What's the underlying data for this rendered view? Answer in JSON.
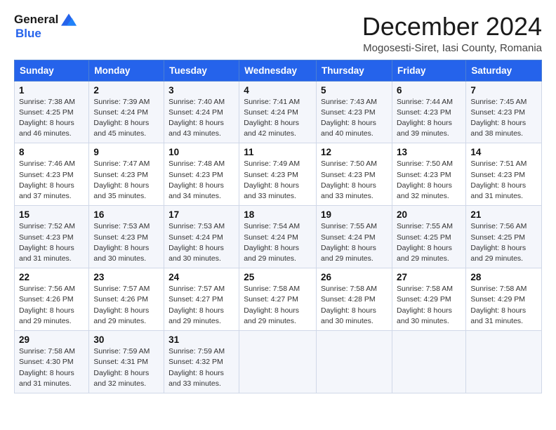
{
  "logo": {
    "general": "General",
    "blue": "Blue"
  },
  "title": "December 2024",
  "subtitle": "Mogosesti-Siret, Iasi County, Romania",
  "headers": [
    "Sunday",
    "Monday",
    "Tuesday",
    "Wednesday",
    "Thursday",
    "Friday",
    "Saturday"
  ],
  "weeks": [
    [
      {
        "day": "1",
        "sunrise": "Sunrise: 7:38 AM",
        "sunset": "Sunset: 4:25 PM",
        "daylight": "Daylight: 8 hours and 46 minutes."
      },
      {
        "day": "2",
        "sunrise": "Sunrise: 7:39 AM",
        "sunset": "Sunset: 4:24 PM",
        "daylight": "Daylight: 8 hours and 45 minutes."
      },
      {
        "day": "3",
        "sunrise": "Sunrise: 7:40 AM",
        "sunset": "Sunset: 4:24 PM",
        "daylight": "Daylight: 8 hours and 43 minutes."
      },
      {
        "day": "4",
        "sunrise": "Sunrise: 7:41 AM",
        "sunset": "Sunset: 4:24 PM",
        "daylight": "Daylight: 8 hours and 42 minutes."
      },
      {
        "day": "5",
        "sunrise": "Sunrise: 7:43 AM",
        "sunset": "Sunset: 4:23 PM",
        "daylight": "Daylight: 8 hours and 40 minutes."
      },
      {
        "day": "6",
        "sunrise": "Sunrise: 7:44 AM",
        "sunset": "Sunset: 4:23 PM",
        "daylight": "Daylight: 8 hours and 39 minutes."
      },
      {
        "day": "7",
        "sunrise": "Sunrise: 7:45 AM",
        "sunset": "Sunset: 4:23 PM",
        "daylight": "Daylight: 8 hours and 38 minutes."
      }
    ],
    [
      {
        "day": "8",
        "sunrise": "Sunrise: 7:46 AM",
        "sunset": "Sunset: 4:23 PM",
        "daylight": "Daylight: 8 hours and 37 minutes."
      },
      {
        "day": "9",
        "sunrise": "Sunrise: 7:47 AM",
        "sunset": "Sunset: 4:23 PM",
        "daylight": "Daylight: 8 hours and 35 minutes."
      },
      {
        "day": "10",
        "sunrise": "Sunrise: 7:48 AM",
        "sunset": "Sunset: 4:23 PM",
        "daylight": "Daylight: 8 hours and 34 minutes."
      },
      {
        "day": "11",
        "sunrise": "Sunrise: 7:49 AM",
        "sunset": "Sunset: 4:23 PM",
        "daylight": "Daylight: 8 hours and 33 minutes."
      },
      {
        "day": "12",
        "sunrise": "Sunrise: 7:50 AM",
        "sunset": "Sunset: 4:23 PM",
        "daylight": "Daylight: 8 hours and 33 minutes."
      },
      {
        "day": "13",
        "sunrise": "Sunrise: 7:50 AM",
        "sunset": "Sunset: 4:23 PM",
        "daylight": "Daylight: 8 hours and 32 minutes."
      },
      {
        "day": "14",
        "sunrise": "Sunrise: 7:51 AM",
        "sunset": "Sunset: 4:23 PM",
        "daylight": "Daylight: 8 hours and 31 minutes."
      }
    ],
    [
      {
        "day": "15",
        "sunrise": "Sunrise: 7:52 AM",
        "sunset": "Sunset: 4:23 PM",
        "daylight": "Daylight: 8 hours and 31 minutes."
      },
      {
        "day": "16",
        "sunrise": "Sunrise: 7:53 AM",
        "sunset": "Sunset: 4:23 PM",
        "daylight": "Daylight: 8 hours and 30 minutes."
      },
      {
        "day": "17",
        "sunrise": "Sunrise: 7:53 AM",
        "sunset": "Sunset: 4:24 PM",
        "daylight": "Daylight: 8 hours and 30 minutes."
      },
      {
        "day": "18",
        "sunrise": "Sunrise: 7:54 AM",
        "sunset": "Sunset: 4:24 PM",
        "daylight": "Daylight: 8 hours and 29 minutes."
      },
      {
        "day": "19",
        "sunrise": "Sunrise: 7:55 AM",
        "sunset": "Sunset: 4:24 PM",
        "daylight": "Daylight: 8 hours and 29 minutes."
      },
      {
        "day": "20",
        "sunrise": "Sunrise: 7:55 AM",
        "sunset": "Sunset: 4:25 PM",
        "daylight": "Daylight: 8 hours and 29 minutes."
      },
      {
        "day": "21",
        "sunrise": "Sunrise: 7:56 AM",
        "sunset": "Sunset: 4:25 PM",
        "daylight": "Daylight: 8 hours and 29 minutes."
      }
    ],
    [
      {
        "day": "22",
        "sunrise": "Sunrise: 7:56 AM",
        "sunset": "Sunset: 4:26 PM",
        "daylight": "Daylight: 8 hours and 29 minutes."
      },
      {
        "day": "23",
        "sunrise": "Sunrise: 7:57 AM",
        "sunset": "Sunset: 4:26 PM",
        "daylight": "Daylight: 8 hours and 29 minutes."
      },
      {
        "day": "24",
        "sunrise": "Sunrise: 7:57 AM",
        "sunset": "Sunset: 4:27 PM",
        "daylight": "Daylight: 8 hours and 29 minutes."
      },
      {
        "day": "25",
        "sunrise": "Sunrise: 7:58 AM",
        "sunset": "Sunset: 4:27 PM",
        "daylight": "Daylight: 8 hours and 29 minutes."
      },
      {
        "day": "26",
        "sunrise": "Sunrise: 7:58 AM",
        "sunset": "Sunset: 4:28 PM",
        "daylight": "Daylight: 8 hours and 30 minutes."
      },
      {
        "day": "27",
        "sunrise": "Sunrise: 7:58 AM",
        "sunset": "Sunset: 4:29 PM",
        "daylight": "Daylight: 8 hours and 30 minutes."
      },
      {
        "day": "28",
        "sunrise": "Sunrise: 7:58 AM",
        "sunset": "Sunset: 4:29 PM",
        "daylight": "Daylight: 8 hours and 31 minutes."
      }
    ],
    [
      {
        "day": "29",
        "sunrise": "Sunrise: 7:58 AM",
        "sunset": "Sunset: 4:30 PM",
        "daylight": "Daylight: 8 hours and 31 minutes."
      },
      {
        "day": "30",
        "sunrise": "Sunrise: 7:59 AM",
        "sunset": "Sunset: 4:31 PM",
        "daylight": "Daylight: 8 hours and 32 minutes."
      },
      {
        "day": "31",
        "sunrise": "Sunrise: 7:59 AM",
        "sunset": "Sunset: 4:32 PM",
        "daylight": "Daylight: 8 hours and 33 minutes."
      },
      null,
      null,
      null,
      null
    ]
  ]
}
